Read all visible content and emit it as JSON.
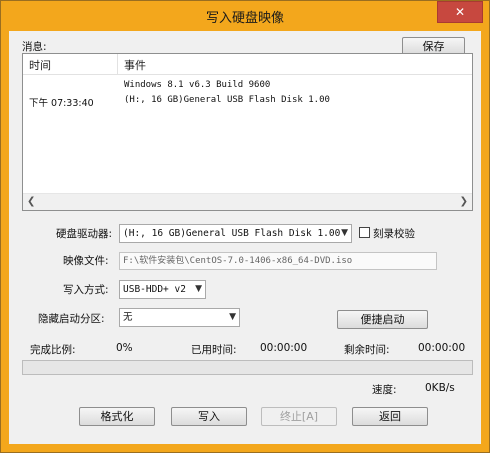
{
  "window": {
    "title": "写入硬盘映像",
    "close_symbol": "✕"
  },
  "messages": {
    "label": "消息:",
    "save_label": "保存",
    "columns": {
      "time": "时间",
      "event": "事件"
    },
    "rows": [
      {
        "time": "",
        "event": "Windows 8.1 v6.3 Build 9600"
      },
      {
        "time": "下午 07:33:40",
        "event": "(H:, 16 GB)General USB Flash Disk  1.00"
      }
    ]
  },
  "form": {
    "drive_label": "硬盘驱动器:",
    "drive_value": "(H:, 16 GB)General USB Flash Disk  1.00",
    "verify_label": "刻录校验",
    "verify_checked": false,
    "image_label": "映像文件:",
    "image_value": "F:\\软件安装包\\CentOS-7.0-1406-x86_64-DVD.iso",
    "write_mode_label": "写入方式:",
    "write_mode_value": "USB-HDD+ v2",
    "hidden_partition_label": "隐藏启动分区:",
    "hidden_partition_value": "无",
    "quick_boot_label": "便捷启动"
  },
  "status": {
    "completion_label": "完成比例:",
    "completion_value": "0%",
    "progress_fraction": 0,
    "elapsed_label": "已用时间:",
    "elapsed_value": "00:00:00",
    "remaining_label": "剩余时间:",
    "remaining_value": "00:00:00",
    "speed_label": "速度:",
    "speed_value": "0KB/s"
  },
  "buttons": {
    "format": "格式化",
    "write": "写入",
    "stop": "终止[A]",
    "back": "返回"
  },
  "icons": {
    "dropdown": "chevron-down-icon",
    "scroll_left": "scroll-left-icon",
    "scroll_right": "scroll-right-icon",
    "close": "close-icon"
  },
  "colors": {
    "title_bar": "#f3a71c",
    "close_button": "#c7483f",
    "progress_fill": "#06b025"
  }
}
